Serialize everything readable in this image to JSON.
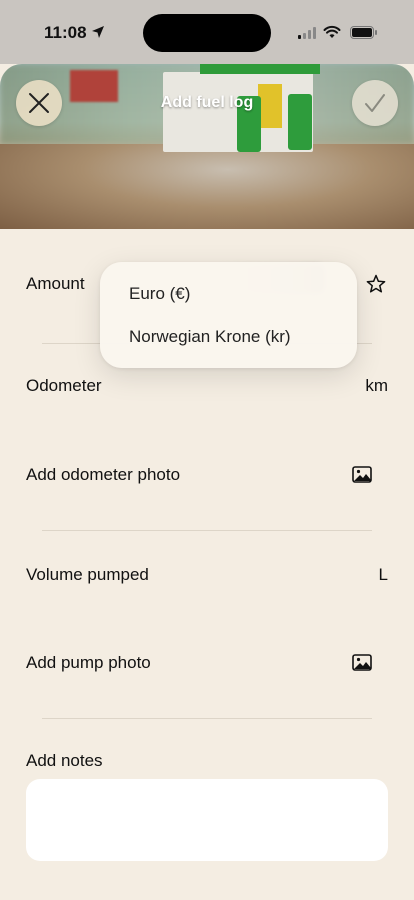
{
  "status_bar": {
    "time": "11:08"
  },
  "header": {
    "title": "Add fuel log"
  },
  "form": {
    "amount_label": "Amount",
    "odometer_label": "Odometer",
    "odometer_unit": "km",
    "odometer_photo_label": "Add odometer photo",
    "volume_label": "Volume pumped",
    "volume_unit": "L",
    "pump_photo_label": "Add pump photo",
    "notes_label": "Add notes",
    "notes_value": ""
  },
  "currency_menu": {
    "options": [
      "Euro (€)",
      "Norwegian Krone (kr)"
    ]
  },
  "icons": {
    "close": "close-icon",
    "done": "checkmark-icon",
    "favorite": "star-icon",
    "photo": "photo-icon"
  },
  "colors": {
    "background": "#f4ede2",
    "pump_green": "#2e9c3c"
  }
}
